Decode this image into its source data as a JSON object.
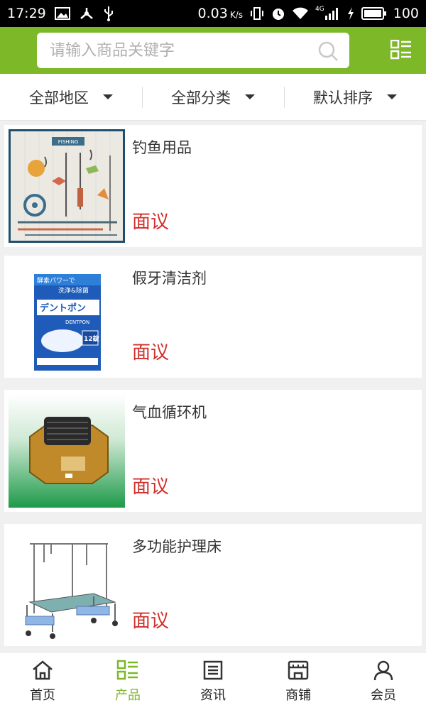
{
  "status": {
    "time": "17:29",
    "speed": "0.03",
    "speed_unit": "K/s",
    "network": "4G",
    "battery": "100"
  },
  "search": {
    "placeholder": "请输入商品关键字"
  },
  "filters": [
    {
      "label": "全部地区"
    },
    {
      "label": "全部分类"
    },
    {
      "label": "默认排序"
    }
  ],
  "products": [
    {
      "name": "钓鱼用品",
      "price": "面议",
      "fishing_banner": "FISHING"
    },
    {
      "name": "假牙清洁剂",
      "price": "面议",
      "box_top": "酵素パワーで",
      "box_sub": "洗浄&除菌",
      "box_brand": "デントポン",
      "box_latin": "DENTPON",
      "box_count": "12錠"
    },
    {
      "name": "气血循环机",
      "price": "面议"
    },
    {
      "name": "多功能护理床",
      "price": "面议"
    }
  ],
  "tabs": [
    {
      "label": "首页",
      "icon": "home-icon"
    },
    {
      "label": "产品",
      "icon": "product-list-icon",
      "active": true
    },
    {
      "label": "资讯",
      "icon": "news-icon"
    },
    {
      "label": "商铺",
      "icon": "shop-icon"
    },
    {
      "label": "会员",
      "icon": "user-icon"
    }
  ],
  "colors": {
    "brand": "#7cb828",
    "price": "#d0302c"
  }
}
